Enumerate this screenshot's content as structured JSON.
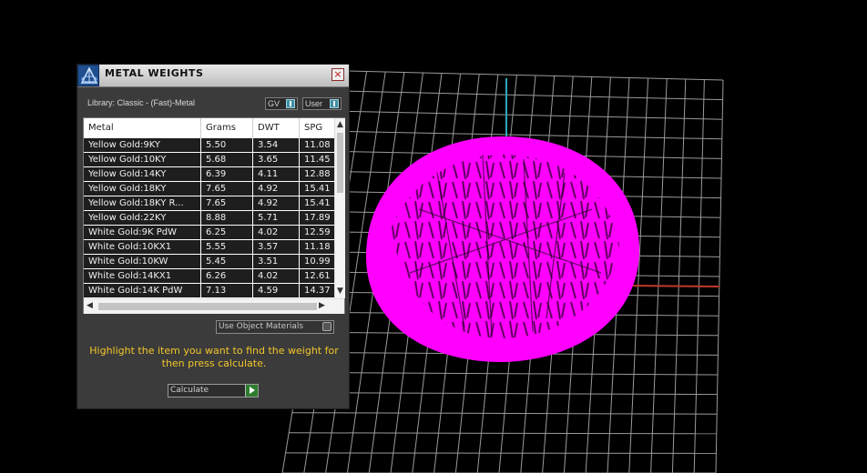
{
  "panel": {
    "title": "METAL WEIGHTS",
    "close_glyph": "×",
    "library_label": "Library: Classic - (Fast)-Metal",
    "gv_label": "GV",
    "user_label": "User",
    "object_materials_label": "Use Object Materials",
    "hint": "Highlight the item you want to find the weight for then press calculate.",
    "calculate_label": "Calculate"
  },
  "table": {
    "columns": [
      "Metal",
      "Grams",
      "DWT",
      "SPG"
    ],
    "rows": [
      [
        "Yellow Gold:9KY",
        "5.50",
        "3.54",
        "11.08"
      ],
      [
        "Yellow Gold:10KY",
        "5.68",
        "3.65",
        "11.45"
      ],
      [
        "Yellow Gold:14KY",
        "6.39",
        "4.11",
        "12.88"
      ],
      [
        "Yellow Gold:18KY",
        "7.65",
        "4.92",
        "15.41"
      ],
      [
        "Yellow Gold:18KY R...",
        "7.65",
        "4.92",
        "15.41"
      ],
      [
        "Yellow Gold:22KY",
        "8.88",
        "5.71",
        "17.89"
      ],
      [
        "White Gold:9K PdW",
        "6.25",
        "4.02",
        "12.59"
      ],
      [
        "White Gold:10KX1",
        "5.55",
        "3.57",
        "11.18"
      ],
      [
        "White Gold:10KW",
        "5.45",
        "3.51",
        "10.99"
      ],
      [
        "White Gold:14KX1",
        "6.26",
        "4.02",
        "12.61"
      ],
      [
        "White Gold:14K PdW",
        "7.13",
        "4.59",
        "14.37"
      ]
    ]
  },
  "scroll_glyphs": {
    "up": "▲",
    "down": "▼",
    "left": "◀",
    "right": "▶"
  },
  "icons": {
    "logo": "app-logo-icon",
    "close": "close-icon",
    "toggle": "toggle-icon",
    "play": "play-icon"
  },
  "colors": {
    "model": "#ff00ff",
    "grid": "#9a9a9a",
    "hint": "#f2c52a",
    "axis_x": "#c0392b",
    "axis_y": "#2aa7b5"
  }
}
